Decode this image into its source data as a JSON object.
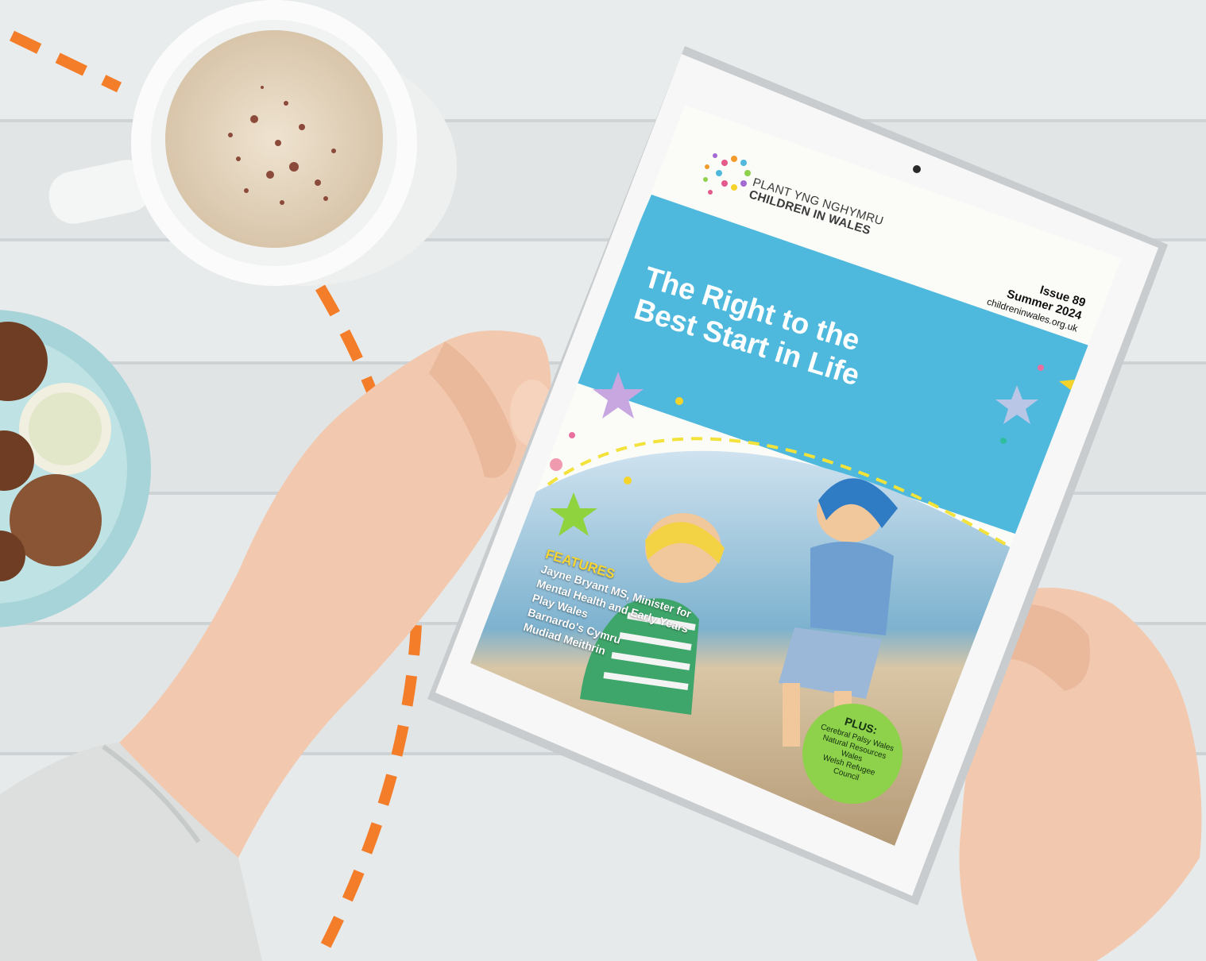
{
  "magazine": {
    "logo_welsh": "PLANT YNG NGHYMRU",
    "logo_english": "CHILDREN IN WALES",
    "title_line1": "The Right to the",
    "title_line2": "Best Start in Life",
    "issue": "Issue 89",
    "season": "Summer 2024",
    "website": "childreninwales.org.uk",
    "features_heading": "FEATURES",
    "features": [
      "Jayne Bryant MS, Minister for",
      "Mental Health and Early Years",
      "Play Wales",
      "Barnardo's Cymru",
      "Mudiad Meithrin"
    ],
    "plus_heading": "PLUS:",
    "plus_items": [
      "Cerebral Palsy Wales",
      "Natural Resources Wales",
      "Welsh Refugee",
      "Council"
    ]
  },
  "colors": {
    "desk": "#e7eaeb",
    "accent_orange": "#f47d2a",
    "cover_blue": "#4fb9dd",
    "plus_green": "#8ed14a",
    "features_yellow": "#f6d633"
  }
}
